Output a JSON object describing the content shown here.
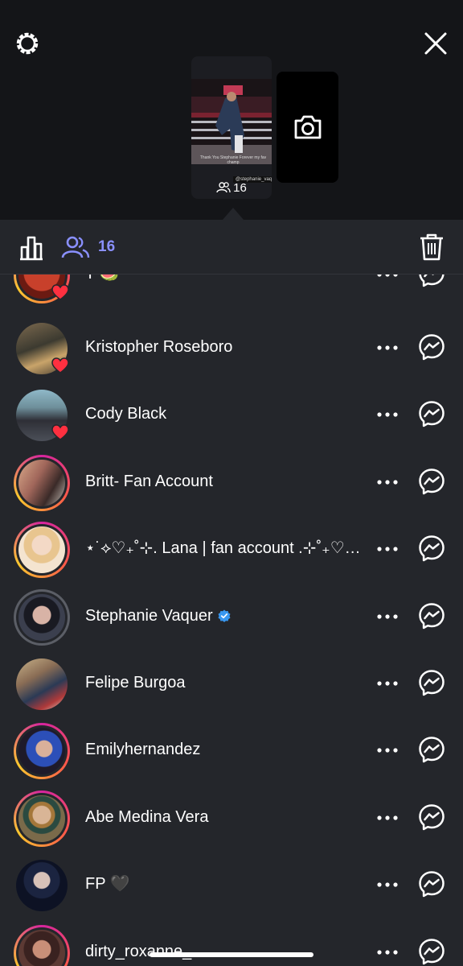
{
  "story": {
    "thumbnail_caption": "Thank You Stephanie Forever my fav champ",
    "thumbnail_handle": "@stephanie_vaquer",
    "viewers_count": "16"
  },
  "toolbar": {
    "viewers_count": "16"
  },
  "colors": {
    "background": "#24262b",
    "top_background": "#141518",
    "accent": "#8a90ff",
    "like_red": "#ff3040",
    "verified_blue": "#3897f0"
  },
  "viewers": [
    {
      "name": "T 🍉",
      "ring": "story",
      "liked": true
    },
    {
      "name": "Kristopher Roseboro",
      "ring": "none",
      "liked": true
    },
    {
      "name": "Cody Black",
      "ring": "none",
      "liked": true
    },
    {
      "name": "Britt- Fan Account",
      "ring": "story",
      "liked": false
    },
    {
      "name": "⋆˙⟡♡₊˚⊹. Lana | fan account .⊹˚₊♡⟡˙⋆",
      "ring": "story",
      "liked": false
    },
    {
      "name": "Stephanie Vaquer",
      "ring": "seen",
      "liked": false,
      "verified": true
    },
    {
      "name": "Felipe Burgoa",
      "ring": "none",
      "liked": false
    },
    {
      "name": "Emilyhernandez",
      "ring": "story",
      "liked": false
    },
    {
      "name": "Abe Medina Vera",
      "ring": "story",
      "liked": false
    },
    {
      "name": "FP 🖤",
      "ring": "none",
      "liked": false
    },
    {
      "name": "dirty_roxanne_",
      "ring": "story",
      "liked": false
    }
  ]
}
